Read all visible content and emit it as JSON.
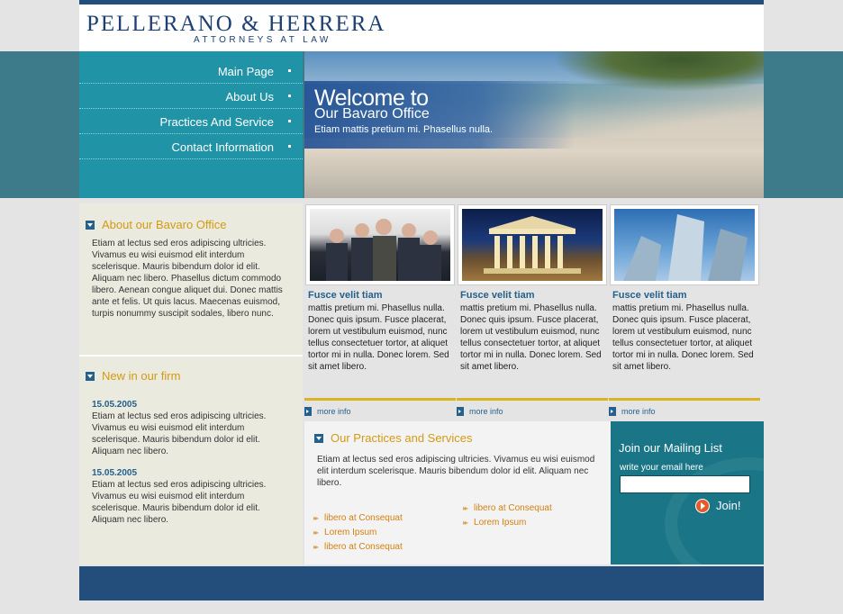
{
  "header": {
    "logo_name": "PELLERANO & HERRERA",
    "logo_tagline": "ATTORNEYS AT LAW"
  },
  "nav": {
    "items": [
      "Main Page",
      "About Us",
      "Practices And Service",
      "Contact Information"
    ]
  },
  "hero": {
    "title": "Welcome to",
    "subtitle": "Our Bavaro Office",
    "tagline": "Etiam mattis pretium mi. Phasellus nulla."
  },
  "about": {
    "heading": "About our Bavaro Office",
    "text": "Etiam at lectus sed eros adipiscing ultricies. Vivamus eu wisi euismod elit interdum scelerisque. Mauris bibendum dolor id elit. Aliquam nec libero. Phasellus dictum commodo libero. Aenean congue aliquet dui. Donec mattis ante et felis. Ut quis lacus. Maecenas euismod, turpis nonummy suscipit sodales, libero nunc."
  },
  "news": {
    "heading": "New in our firm",
    "items": [
      {
        "date": "15.05.2005",
        "text": "Etiam at lectus sed eros adipiscing ultricies. Vivamus eu wisi euismod elit interdum scelerisque. Mauris bibendum dolor id elit. Aliquam nec libero."
      },
      {
        "date": "15.05.2005",
        "text": "Etiam at lectus sed eros adipiscing ultricies. Vivamus eu wisi euismod elit interdum scelerisque. Mauris bibendum dolor id elit. Aliquam nec libero."
      }
    ]
  },
  "features": [
    {
      "title": "Fusce velit tiam",
      "text": "mattis pretium mi. Phasellus nulla. Donec quis ipsum. Fusce placerat, lorem ut vestibulum euismod, nunc tellus consectetuer tortor, at aliquet tortor mi in nulla. Donec lorem. Sed sit amet libero.",
      "more": "more info"
    },
    {
      "title": "Fusce velit tiam",
      "text": "mattis pretium mi. Phasellus nulla. Donec quis ipsum. Fusce placerat, lorem ut vestibulum euismod, nunc tellus consectetuer tortor, at aliquet tortor mi in nulla. Donec lorem. Sed sit amet libero.",
      "more": "more info"
    },
    {
      "title": "Fusce velit tiam",
      "text": "mattis pretium mi. Phasellus nulla. Donec quis ipsum. Fusce placerat, lorem ut vestibulum euismod, nunc tellus consectetuer tortor, at aliquet tortor mi in nulla. Donec lorem. Sed sit amet libero.",
      "more": "more info"
    }
  ],
  "practices": {
    "heading": "Our Practices and Services",
    "text": "Etiam at lectus sed eros adipiscing ultricies. Vivamus eu wisi euismod elit interdum scelerisque. Mauris bibendum dolor id elit. Aliquam nec libero.",
    "links_left": [
      "libero at Consequat",
      "Lorem Ipsum",
      "libero at Consequat"
    ],
    "links_right": [
      "libero at Consequat",
      "Lorem Ipsum"
    ]
  },
  "mailing": {
    "heading": "Join our Mailing List",
    "label": "write your email here",
    "value": "",
    "button": "Join!"
  },
  "colors": {
    "navy": "#234d7a",
    "teal": "#2193a6",
    "gold": "#d39a12",
    "link_orange": "#d38012"
  }
}
